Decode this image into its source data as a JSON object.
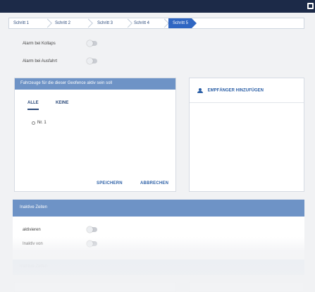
{
  "steps": [
    {
      "label": "Schritt 1",
      "active": false
    },
    {
      "label": "Schritt 2",
      "active": false
    },
    {
      "label": "Schritt 3",
      "active": false
    },
    {
      "label": "Schritt 4",
      "active": false
    },
    {
      "label": "Schritt 5",
      "active": true
    }
  ],
  "alarm_toggles": [
    {
      "label": "Alarm bei Kollaps",
      "on": false
    },
    {
      "label": "Alarm bei Ausfahrt",
      "on": false
    }
  ],
  "vehicle_card": {
    "title": "Fahrzeuge für die dieser Geofence aktiv sein soll",
    "tabs": [
      "ALLE",
      "KEINE"
    ],
    "active_tab": "ALLE",
    "radio_label": "Nr. 1",
    "save_label": "SPEICHERN",
    "cancel_label": "ABBRECHEN"
  },
  "recipient_card": {
    "add_label": "EMPFÄNGER HINZUFÜGEN",
    "icon": "person-add-icon"
  },
  "extra_section": {
    "title": "Inaktive Zeiten",
    "toggles": [
      {
        "label": "aktivieren",
        "on": false
      },
      {
        "label": "Inaktiv von",
        "on": false
      }
    ],
    "next_section_title": "Inaktive Zeiten"
  },
  "colors": {
    "topbar": "#1c2a48",
    "step_active": "#2f66c2",
    "card_header": "#6e93c6",
    "link": "#2b5fa6"
  }
}
